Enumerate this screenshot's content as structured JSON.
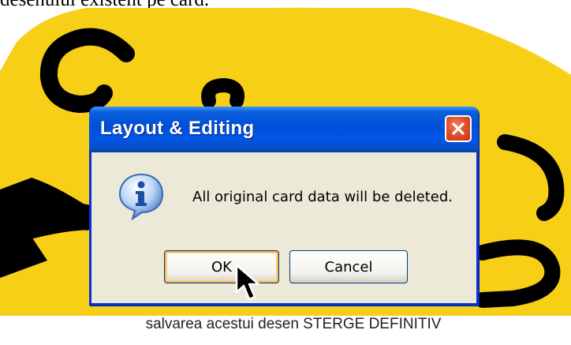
{
  "page": {
    "top_caption": "desenului existent pe card.",
    "bottom_caption": "salvarea acestui desen STERGE DEFINITIV"
  },
  "dialog": {
    "title": "Layout & Editing",
    "message": "All original card data will be deleted.",
    "icon": "info-icon",
    "buttons": {
      "ok_label": "OK",
      "cancel_label": "Cancel"
    }
  },
  "colors": {
    "card_background": "#f7cf17",
    "drawing_stroke": "#000000",
    "titlebar": "#0050d8",
    "dialog_body": "#ece9d8",
    "close_button": "#e0512f"
  }
}
